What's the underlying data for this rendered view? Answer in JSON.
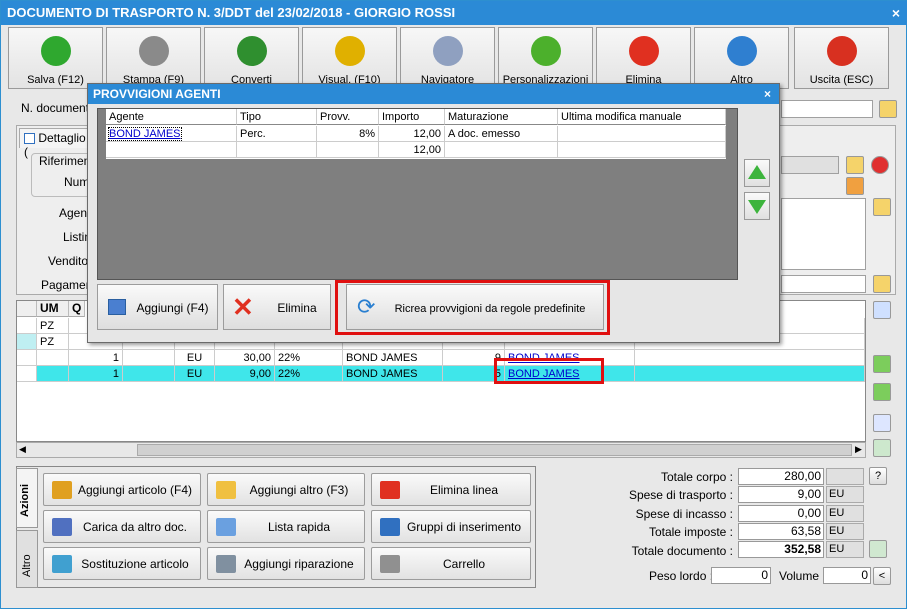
{
  "window": {
    "title": "DOCUMENTO DI TRASPORTO N. 3/DDT del 23/02/2018 - GIORGIO ROSSI",
    "close": "×"
  },
  "toolbar": [
    {
      "label": "Salva (F12)",
      "icon": "check-icon",
      "color": "#2fa82f"
    },
    {
      "label": "Stampa (F9)",
      "icon": "printer-icon",
      "color": "#8a8a8a"
    },
    {
      "label": "Converti",
      "icon": "convert-icon",
      "color": "#2f8f2f"
    },
    {
      "label": "Visual. (F10)",
      "icon": "magic-wand-icon",
      "color": "#e0b000"
    },
    {
      "label": "Navigatore",
      "icon": "compass-icon",
      "color": "#8fa0c0"
    },
    {
      "label": "Personalizzazioni",
      "icon": "puzzle-icon",
      "color": "#4cb02c"
    },
    {
      "label": "Elimina",
      "icon": "delete-x-icon",
      "color": "#e03020"
    },
    {
      "label": "Altro",
      "icon": "magnifier-icon",
      "color": "#2f7fd0"
    },
    {
      "label": "Uscita (ESC)",
      "icon": "exit-icon",
      "color": "#d83020"
    }
  ],
  "header": {
    "doc_number_label": "N. documento",
    "tab_detail": "Dettaglio (",
    "riferimenti": "Riferiment",
    "num": "Num.",
    "agente": "Agent",
    "listino": "Listin",
    "venditore": "Venditor",
    "pagamento": "Pagament"
  },
  "grid": {
    "cols": [
      "UM",
      "Q"
    ],
    "rows": [
      {
        "um": "PZ",
        "qty": "",
        "curr": "",
        "price": "",
        "iva": "",
        "agent": "",
        "n": "",
        "link": ""
      },
      {
        "um": "PZ",
        "qty": "",
        "curr": "",
        "price": "",
        "iva": "",
        "agent": "",
        "n": "",
        "link": ""
      },
      {
        "um": "",
        "qty": "1",
        "curr": "EU",
        "price": "30,00",
        "iva": "22%",
        "agent": "BOND JAMES",
        "n": "9",
        "link": "BOND JAMES"
      },
      {
        "um": "",
        "qty": "1",
        "curr": "EU",
        "price": "9,00",
        "iva": "22%",
        "agent": "BOND JAMES",
        "n": "5",
        "link": "BOND JAMES"
      }
    ]
  },
  "modal": {
    "title": "PROVVIGIONI AGENTI",
    "close": "×",
    "columns": [
      "Agente",
      "Tipo",
      "Provv.",
      "Importo",
      "Maturazione",
      "Ultima modifica manuale"
    ],
    "rows": [
      {
        "agente": "BOND JAMES",
        "tipo": "Perc.",
        "provv": "8%",
        "importo": "12,00",
        "maturazione": "A doc. emesso",
        "ultima": ""
      },
      {
        "agente": "",
        "tipo": "",
        "provv": "",
        "importo": "12,00",
        "maturazione": "",
        "ultima": ""
      }
    ],
    "buttons": {
      "add": "Aggiungi (F4)",
      "delete": "Elimina",
      "recreate": "Ricrea provvigioni da regole predefinite"
    }
  },
  "side_tabs": {
    "azioni": "Azioni",
    "altro": "Altro"
  },
  "actions": [
    {
      "label": "Aggiungi articolo (F4)",
      "icon": "box-add-icon"
    },
    {
      "label": "Aggiungi altro (F3)",
      "icon": "grid-add-icon"
    },
    {
      "label": "Elimina linea",
      "icon": "delete-x-icon"
    },
    {
      "label": "Carica da altro doc.",
      "icon": "doc-load-icon"
    },
    {
      "label": "Lista rapida",
      "icon": "list-icon"
    },
    {
      "label": "Gruppi di inserimento",
      "icon": "group-add-icon"
    },
    {
      "label": "Sostituzione articolo",
      "icon": "swap-icon"
    },
    {
      "label": "Aggiungi riparazione",
      "icon": "wrench-icon"
    },
    {
      "label": "Carrello",
      "icon": "cart-icon"
    }
  ],
  "totals": {
    "corpo_label": "Totale corpo :",
    "corpo": "280,00",
    "trasporto_label": "Spese di trasporto :",
    "trasporto": "9,00",
    "trasporto_cur": "EU",
    "incasso_label": "Spese di incasso :",
    "incasso": "0,00",
    "incasso_cur": "EU",
    "imposte_label": "Totale imposte :",
    "imposte": "63,58",
    "imposte_cur": "EU",
    "documento_label": "Totale documento :",
    "documento": "352,58",
    "documento_cur": "EU",
    "peso_label": "Peso lordo :",
    "peso": "0",
    "volume_label": "Volume :",
    "volume": "0",
    "help": "?",
    "lt": "<"
  }
}
